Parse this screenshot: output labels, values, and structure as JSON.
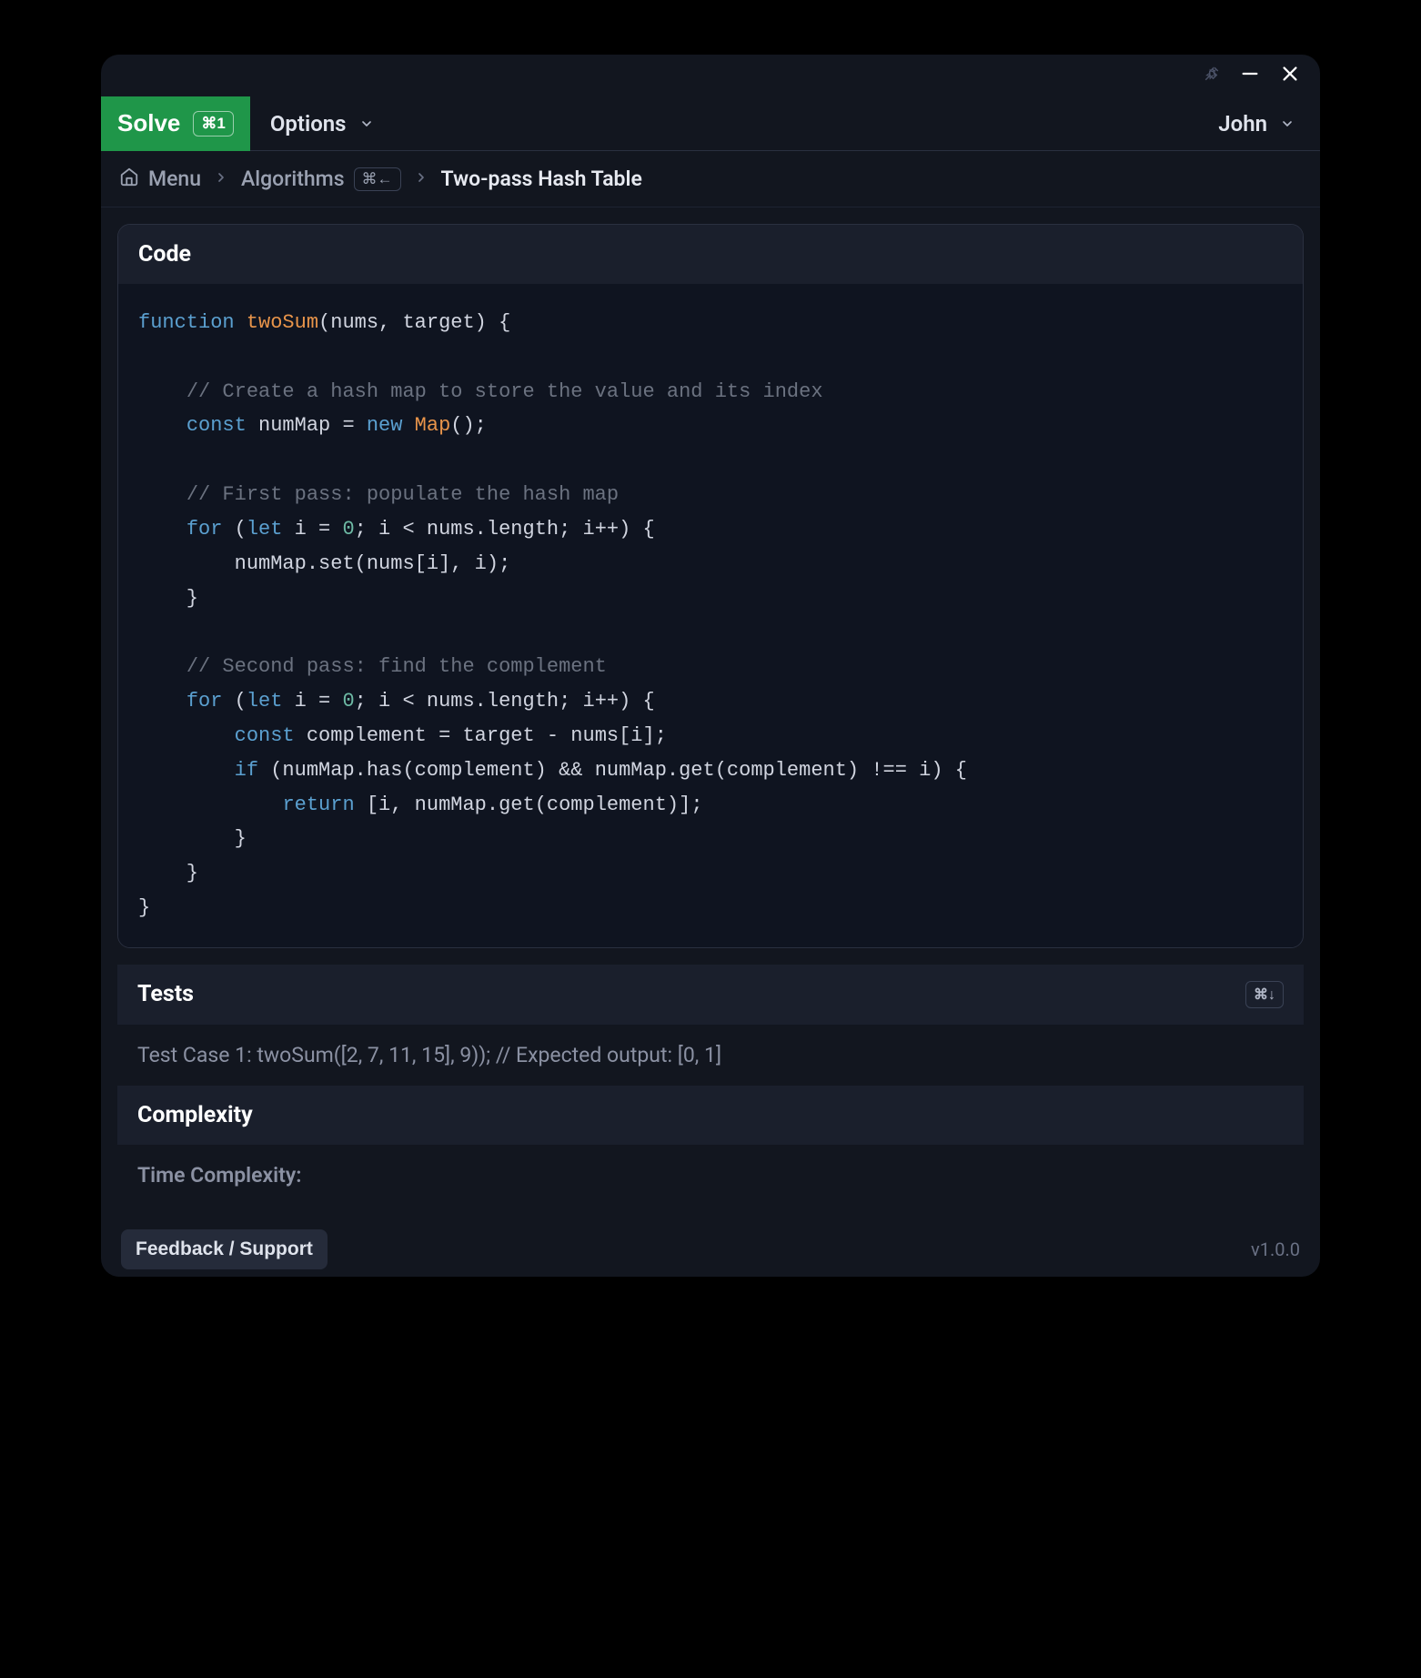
{
  "titlebar": {
    "pin_icon": "pin",
    "minimize_icon": "minimize",
    "close_icon": "close"
  },
  "toolbar": {
    "solve_label": "Solve",
    "solve_shortcut": "⌘1",
    "options_label": "Options",
    "user_label": "John"
  },
  "breadcrumb": {
    "menu_label": "Menu",
    "algorithms_label": "Algorithms",
    "algorithms_shortcut": "⌘←",
    "current_label": "Two-pass Hash Table"
  },
  "panels": {
    "code": {
      "title": "Code",
      "tokens": [
        {
          "t": "kw",
          "v": "function"
        },
        {
          "t": "",
          "v": " "
        },
        {
          "t": "fn",
          "v": "twoSum"
        },
        {
          "t": "",
          "v": "(nums, target) {\n\n    "
        },
        {
          "t": "comment",
          "v": "// Create a hash map to store the value and its index"
        },
        {
          "t": "",
          "v": "\n    "
        },
        {
          "t": "kw",
          "v": "const"
        },
        {
          "t": "",
          "v": " numMap = "
        },
        {
          "t": "kw",
          "v": "new"
        },
        {
          "t": "",
          "v": " "
        },
        {
          "t": "type",
          "v": "Map"
        },
        {
          "t": "",
          "v": "();\n\n    "
        },
        {
          "t": "comment",
          "v": "// First pass: populate the hash map"
        },
        {
          "t": "",
          "v": "\n    "
        },
        {
          "t": "kw",
          "v": "for"
        },
        {
          "t": "",
          "v": " ("
        },
        {
          "t": "kw",
          "v": "let"
        },
        {
          "t": "",
          "v": " i = "
        },
        {
          "t": "num",
          "v": "0"
        },
        {
          "t": "",
          "v": "; i < nums.length; i++) {\n        numMap.set(nums[i], i);\n    }\n\n    "
        },
        {
          "t": "comment",
          "v": "// Second pass: find the complement"
        },
        {
          "t": "",
          "v": "\n    "
        },
        {
          "t": "kw",
          "v": "for"
        },
        {
          "t": "",
          "v": " ("
        },
        {
          "t": "kw",
          "v": "let"
        },
        {
          "t": "",
          "v": " i = "
        },
        {
          "t": "num",
          "v": "0"
        },
        {
          "t": "",
          "v": "; i < nums.length; i++) {\n        "
        },
        {
          "t": "kw",
          "v": "const"
        },
        {
          "t": "",
          "v": " complement = target - nums[i];\n        "
        },
        {
          "t": "kw",
          "v": "if"
        },
        {
          "t": "",
          "v": " (numMap.has(complement) && numMap.get(complement) !== i) {\n            "
        },
        {
          "t": "kw",
          "v": "return"
        },
        {
          "t": "",
          "v": " [i, numMap.get(complement)];\n        }\n    }\n}"
        }
      ]
    },
    "tests": {
      "title": "Tests",
      "shortcut": "⌘↓",
      "body": "Test Case 1: twoSum([2, 7, 11, 15], 9)); // Expected output: [0, 1]"
    },
    "complexity": {
      "title": "Complexity",
      "body": "Time Complexity:"
    }
  },
  "footer": {
    "feedback_label": "Feedback / Support",
    "version": "v1.0.0"
  }
}
